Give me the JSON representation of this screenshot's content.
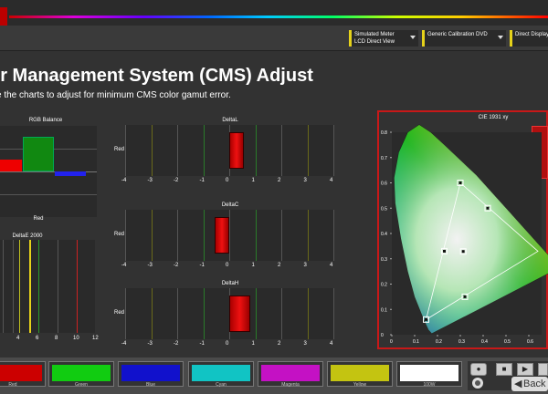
{
  "toolbar": {
    "meter": {
      "line1": "Simulated Meter",
      "line2": "LCD Direct View"
    },
    "disc": {
      "line1": "Generic Calibration DVD",
      "line2": ""
    },
    "display": {
      "line1": "Direct Display",
      "line2": ""
    }
  },
  "page": {
    "title": "or Management System (CMS) Adjust",
    "subtitle": "e the charts to adjust for minimum CMS color gamut error."
  },
  "rgb_balance": {
    "title": "RGB Balance",
    "xlabel": "Red",
    "bars": [
      {
        "name": "red",
        "value": 1.2,
        "color": "#ee0000"
      },
      {
        "name": "green",
        "value": 3.5,
        "color": "#118811"
      },
      {
        "name": "blue",
        "value": -0.5,
        "color": "#2222ee"
      }
    ]
  },
  "deltae": {
    "title": "DeltaE 2000",
    "ticks": [
      "4",
      "6",
      "8",
      "10",
      "12"
    ]
  },
  "delta_charts": [
    {
      "title": "DeltaL",
      "ylabel": "Red",
      "value": 0.5
    },
    {
      "title": "DeltaC",
      "ylabel": "Red",
      "value": -0.3
    },
    {
      "title": "DeltaH",
      "ylabel": "Red",
      "value": 0.8
    }
  ],
  "delta_ticks": [
    "-4",
    "-3",
    "-2",
    "-1",
    "0",
    "1",
    "2",
    "3",
    "4"
  ],
  "cie": {
    "title": "CIE 1931 xy",
    "y_ticks": [
      "0.8",
      "0.7",
      "0.6",
      "0.5",
      "0.4",
      "0.3",
      "0.2",
      "0.1",
      "0"
    ],
    "x_ticks": [
      "0",
      "0.1",
      "0.2",
      "0.3",
      "0.4",
      "0.5",
      "0.6"
    ],
    "ref_primaries": [
      [
        0.64,
        0.33
      ],
      [
        0.3,
        0.6
      ],
      [
        0.15,
        0.06
      ]
    ],
    "markers": [
      {
        "name": "green",
        "x": 0.3,
        "y": 0.6
      },
      {
        "name": "yellow",
        "x": 0.42,
        "y": 0.5
      },
      {
        "name": "cyan",
        "x": 0.23,
        "y": 0.33
      },
      {
        "name": "white",
        "x": 0.3127,
        "y": 0.329
      },
      {
        "name": "magenta",
        "x": 0.32,
        "y": 0.15
      },
      {
        "name": "blue",
        "x": 0.15,
        "y": 0.06
      }
    ]
  },
  "swatches": [
    {
      "label": "Red",
      "color": "#cc0000"
    },
    {
      "label": "Green",
      "color": "#11cc11"
    },
    {
      "label": "Blue",
      "color": "#1111cc"
    },
    {
      "label": "Cyan",
      "color": "#11c4c4"
    },
    {
      "label": "Magenta",
      "color": "#c411c4"
    },
    {
      "label": "Yellow",
      "color": "#c4c411"
    },
    {
      "label": "100W",
      "color": "#ffffff"
    }
  ],
  "controls": {
    "back": "Back"
  }
}
